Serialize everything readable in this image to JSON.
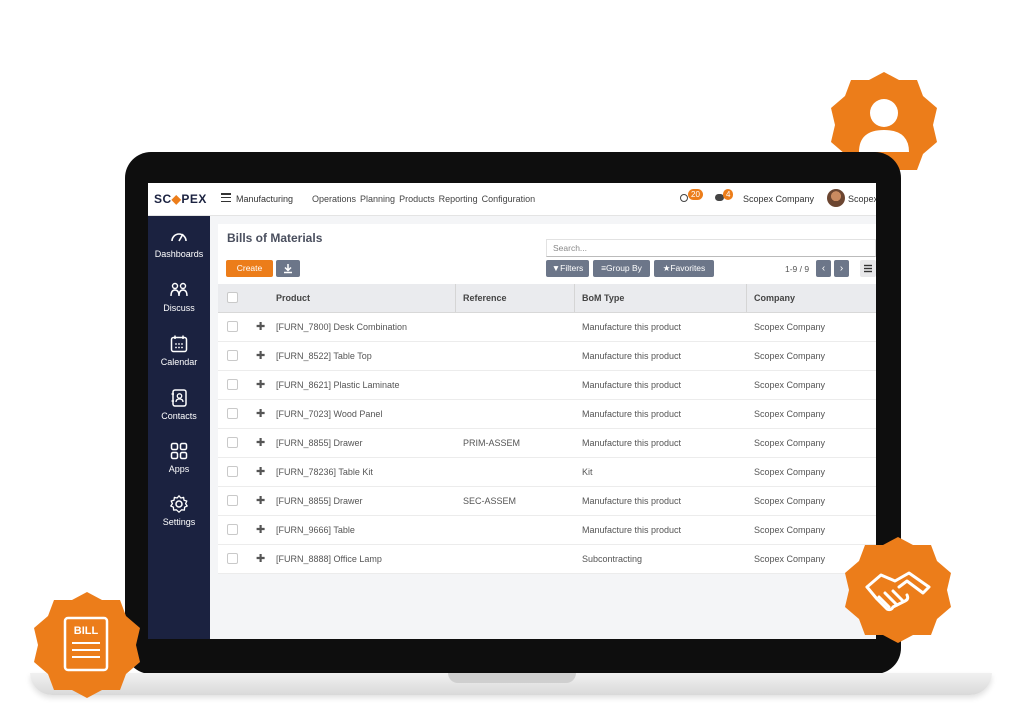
{
  "brand": {
    "logo_prefix": "SC",
    "logo_mark": "◆",
    "logo_suffix": "PEX",
    "accent_color": "#ec7d1a",
    "sidebar_color": "#1b2240"
  },
  "topbar": {
    "app_name": "Manufacturing",
    "menu": [
      "Operations",
      "Planning",
      "Products",
      "Reporting",
      "Configuration"
    ],
    "activity_count": "20",
    "message_count": "4",
    "company": "Scopex Company",
    "user": "Scopex"
  },
  "sidebar": {
    "items": [
      {
        "label": "Dashboards",
        "icon": "gauge-icon"
      },
      {
        "label": "Discuss",
        "icon": "people-icon"
      },
      {
        "label": "Calendar",
        "icon": "calendar-icon"
      },
      {
        "label": "Contacts",
        "icon": "contact-book-icon"
      },
      {
        "label": "Apps",
        "icon": "apps-grid-icon"
      },
      {
        "label": "Settings",
        "icon": "gear-icon"
      }
    ]
  },
  "control_panel": {
    "title": "Bills of Materials",
    "create_label": "Create",
    "search_placeholder": "Search...",
    "filters_label": "Filters",
    "group_by_label": "Group By",
    "favorites_label": "Favorites",
    "pager": "1-9 / 9"
  },
  "table": {
    "columns": [
      "Product",
      "Reference",
      "BoM Type",
      "Company"
    ],
    "rows": [
      {
        "product": "[FURN_7800] Desk Combination",
        "reference": "",
        "bom_type": "Manufacture this product",
        "company": "Scopex Company"
      },
      {
        "product": "[FURN_8522] Table Top",
        "reference": "",
        "bom_type": "Manufacture this product",
        "company": "Scopex Company"
      },
      {
        "product": "[FURN_8621] Plastic Laminate",
        "reference": "",
        "bom_type": "Manufacture this product",
        "company": "Scopex Company"
      },
      {
        "product": "[FURN_7023] Wood Panel",
        "reference": "",
        "bom_type": "Manufacture this product",
        "company": "Scopex Company"
      },
      {
        "product": "[FURN_8855] Drawer",
        "reference": "PRIM-ASSEM",
        "bom_type": "Manufacture this product",
        "company": "Scopex Company"
      },
      {
        "product": "[FURN_78236] Table Kit",
        "reference": "",
        "bom_type": "Kit",
        "company": "Scopex Company"
      },
      {
        "product": "[FURN_8855] Drawer",
        "reference": "SEC-ASSEM",
        "bom_type": "Manufacture this product",
        "company": "Scopex Company"
      },
      {
        "product": "[FURN_9666] Table",
        "reference": "",
        "bom_type": "Manufacture this product",
        "company": "Scopex Company"
      },
      {
        "product": "[FURN_8888] Office Lamp",
        "reference": "",
        "bom_type": "Subcontracting",
        "company": "Scopex Company"
      }
    ]
  },
  "decorations": {
    "bill_badge_text": "BILL",
    "badges": [
      "user-icon",
      "bill-icon",
      "handshake-icon"
    ]
  }
}
